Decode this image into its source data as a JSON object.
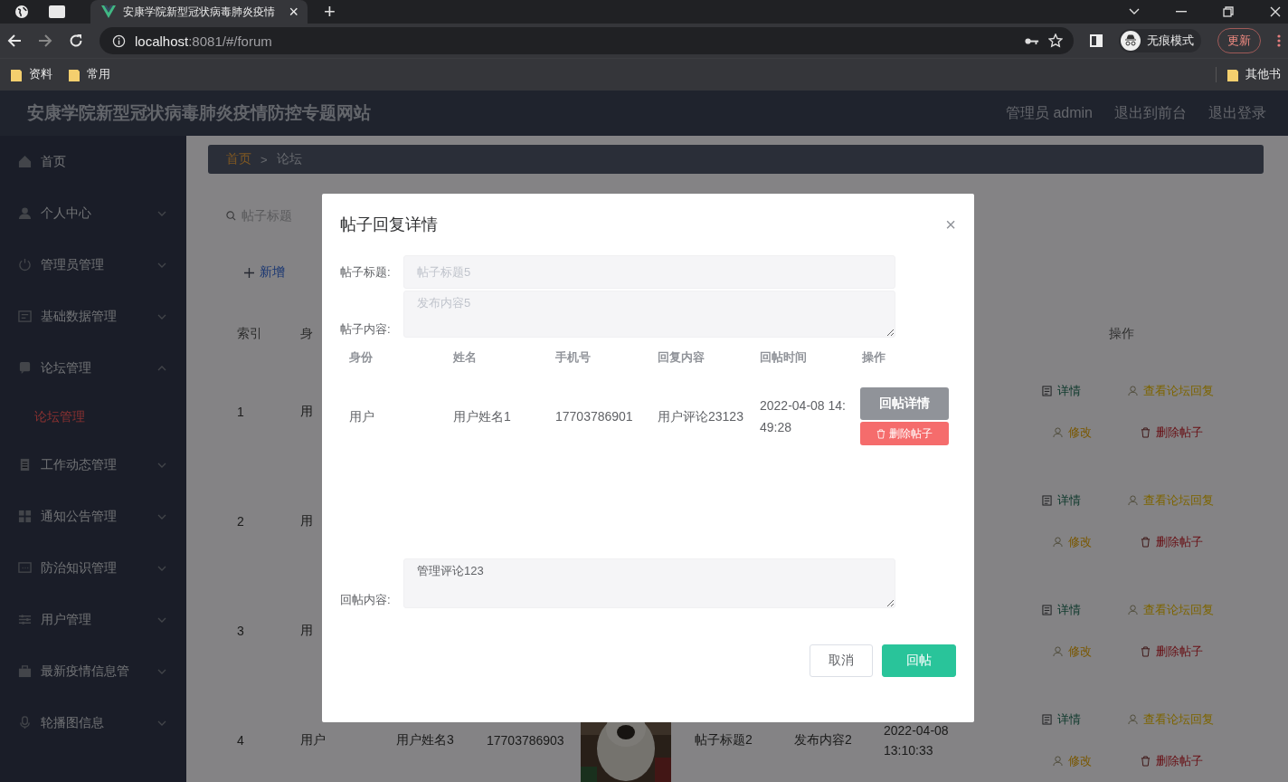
{
  "browser": {
    "tabs": [
      {
        "title": "安康学院新型冠状病毒肺炎疫情",
        "close": "×",
        "selected": true
      }
    ],
    "new_tab": "+",
    "url_host": "localhost",
    "url_rest": ":8081/#/forum",
    "profile": "无痕模式",
    "update_button": "更新",
    "bookmarks": [
      "资料",
      "常用"
    ],
    "other_bookmarks": "其他书"
  },
  "header": {
    "title": "安康学院新型冠状病毒肺炎疫情防控专题网站",
    "links": [
      "管理员 admin",
      "退出到前台",
      "退出登录"
    ]
  },
  "sidebar": {
    "items": [
      {
        "label": "首页",
        "kind": "link"
      },
      {
        "label": "个人中心",
        "kind": "menu",
        "expanded": false
      },
      {
        "label": "管理员管理",
        "kind": "menu",
        "expanded": false
      },
      {
        "label": "基础数据管理",
        "kind": "menu",
        "expanded": false
      },
      {
        "label": "论坛管理",
        "kind": "menu",
        "expanded": true,
        "children": [
          {
            "label": "论坛管理",
            "selected": true
          }
        ]
      },
      {
        "label": "工作动态管理",
        "kind": "menu",
        "expanded": false
      },
      {
        "label": "通知公告管理",
        "kind": "menu",
        "expanded": false
      },
      {
        "label": "防治知识管理",
        "kind": "menu",
        "expanded": false
      },
      {
        "label": "用户管理",
        "kind": "menu",
        "expanded": false
      },
      {
        "label": "最新疫情信息管",
        "kind": "menu",
        "expanded": false
      },
      {
        "label": "轮播图信息",
        "kind": "menu",
        "expanded": false
      }
    ]
  },
  "breadcrumb": [
    {
      "label": "首页",
      "selected": false
    },
    {
      "separator": ">",
      "label": "论坛",
      "selected": true
    }
  ],
  "toolbar": {
    "search_placeholder": "帖子标题",
    "add_button": "新增"
  },
  "table": {
    "columns": {
      "index": "索引",
      "identity": "身",
      "actions": "操作"
    },
    "rows": [
      {
        "index": "1",
        "identity": "用",
        "actions": [
          "详情",
          "查看论坛回复",
          "修改",
          "删除帖子"
        ]
      },
      {
        "index": "2",
        "identity": "用",
        "actions": [
          "详情",
          "查看论坛回复",
          "修改",
          "删除帖子"
        ]
      },
      {
        "index": "3",
        "identity": "用",
        "actions": [
          "详情",
          "查看论坛回复",
          "修改",
          "删除帖子"
        ]
      },
      {
        "index": "4",
        "identity": "用户",
        "name": "用户姓名3",
        "phone": "17703786903",
        "picture": {
          "kind": "picture"
        },
        "title": "帖子标题2",
        "content": "发布内容2",
        "time": "2022-04-08 13:10:33",
        "actions": [
          "详情",
          "查看论坛回复",
          "修改",
          "删除帖子"
        ]
      }
    ]
  },
  "dialog": {
    "title": "帖子回复详情",
    "close": "×",
    "post_title_label": "帖子标题:",
    "post_title_value": "帖子标题5",
    "post_content_label": "帖子内容:",
    "post_content_value": "发布内容5",
    "replies": {
      "columns": [
        "身份",
        "姓名",
        "手机号",
        "回复内容",
        "回帖时间",
        "操作"
      ],
      "rows": [
        {
          "cells": [
            "用户",
            "用户姓名1",
            "17703786901",
            "用户评论23123",
            "2022-04-08 14:49:28"
          ],
          "actions": [
            "回帖详情",
            "删除帖子"
          ]
        }
      ]
    },
    "reply_label": "回帖内容:",
    "reply_value": "管理评论123",
    "buttons": [
      {
        "label": "取消",
        "kind": "cancel"
      },
      {
        "label": "回帖",
        "kind": "submit"
      }
    ]
  }
}
